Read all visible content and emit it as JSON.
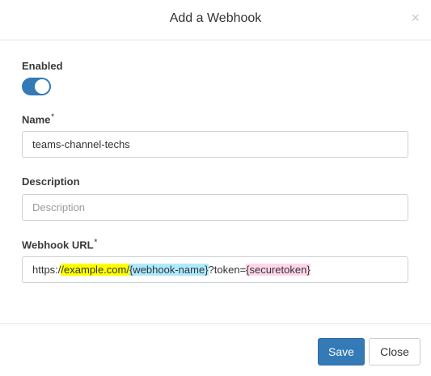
{
  "modal": {
    "title": "Add a Webhook",
    "close_icon": "close-icon",
    "close_glyph": "×"
  },
  "form": {
    "enabled": {
      "label": "Enabled",
      "value": true
    },
    "name": {
      "label": "Name",
      "required_mark": "*",
      "value": "teams-channel-techs"
    },
    "description": {
      "label": "Description",
      "value": "",
      "placeholder": "Description"
    },
    "webhook_url": {
      "label": "Webhook URL",
      "required_mark": "*",
      "parts": {
        "prefix": "https:/",
        "domain": "/example.com/",
        "sep": "/",
        "name_token": "{webhook-name}",
        "query": "?token=",
        "secure_token": "{securetoken}"
      }
    }
  },
  "footer": {
    "save_label": "Save",
    "close_label": "Close"
  },
  "colors": {
    "primary": "#337ab7",
    "highlight_yellow": "#ffff00",
    "highlight_cyan": "#aeeaff",
    "highlight_pink": "#ffd6ea"
  }
}
